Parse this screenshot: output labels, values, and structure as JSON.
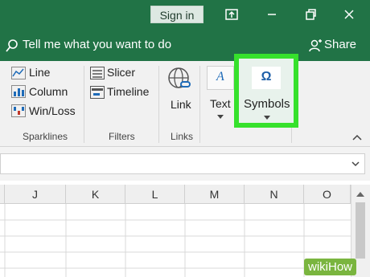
{
  "titlebar": {
    "sign_in": "Sign in"
  },
  "tellbar": {
    "search_text": "Tell me what you want to do",
    "share": "Share"
  },
  "ribbon": {
    "sparklines": {
      "items": [
        "Line",
        "Column",
        "Win/Loss"
      ],
      "label": "Sparklines"
    },
    "filters": {
      "items": [
        "Slicer",
        "Timeline"
      ],
      "label": "Filters"
    },
    "links": {
      "link": "Link",
      "label": "Links"
    },
    "text": {
      "label": "Text"
    },
    "symbols": {
      "label": "Symbols",
      "glyph": "Ω"
    }
  },
  "grid": {
    "columns": [
      "J",
      "K",
      "L",
      "M",
      "N",
      "O"
    ]
  },
  "watermark": {
    "text": "wikiHow"
  },
  "colors": {
    "excel_green": "#217346",
    "highlight": "#36e12c"
  }
}
